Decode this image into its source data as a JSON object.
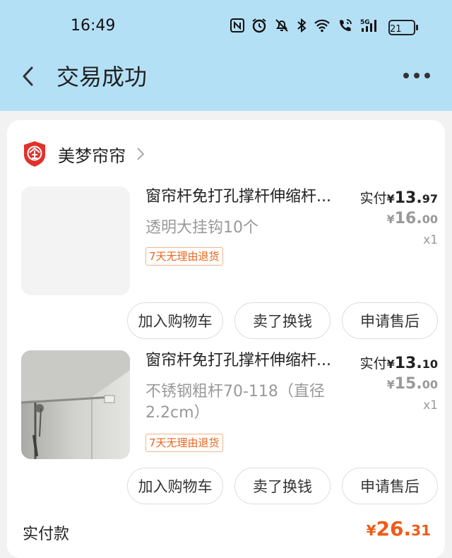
{
  "status_bar": {
    "time": "16:49",
    "battery": "21",
    "icons": [
      "nfc-icon",
      "alarm-icon",
      "mute-icon",
      "bluetooth-icon",
      "wifi-icon",
      "wifi-call-icon",
      "5g-signal-icon",
      "battery-icon"
    ]
  },
  "nav": {
    "title": "交易成功"
  },
  "shop": {
    "name": "美梦帘帘"
  },
  "items": [
    {
      "title": "窗帘杆免打孔撑杆伸缩杆...",
      "spec": "透明大挂钩10个",
      "badge": "7天无理由退货",
      "paid_label": "实付",
      "paid_yen": "¥",
      "paid_int": "13.",
      "paid_dec": "97",
      "orig_yen": "¥",
      "orig_int": "16.",
      "orig_dec": "00",
      "qty": "x1",
      "has_image": false
    },
    {
      "title": "窗帘杆免打孔撑杆伸缩杆...",
      "spec": "不锈钢粗杆70-118（直径2.2cm）",
      "badge": "7天无理由退货",
      "paid_label": "实付",
      "paid_yen": "¥",
      "paid_int": "13.",
      "paid_dec": "10",
      "orig_yen": "¥",
      "orig_int": "15.",
      "orig_dec": "00",
      "qty": "x1",
      "has_image": true
    }
  ],
  "actions": {
    "add_cart": "加入购物车",
    "resell": "卖了换钱",
    "after_sale": "申请售后"
  },
  "total": {
    "label": "实付款",
    "yen": "¥",
    "int": "26.",
    "dec": "31"
  },
  "colors": {
    "header_bg": "#b4e0f6",
    "accent_orange": "#ee5b16",
    "badge_orange": "#e9651c",
    "shop_logo_red": "#e0322b"
  }
}
